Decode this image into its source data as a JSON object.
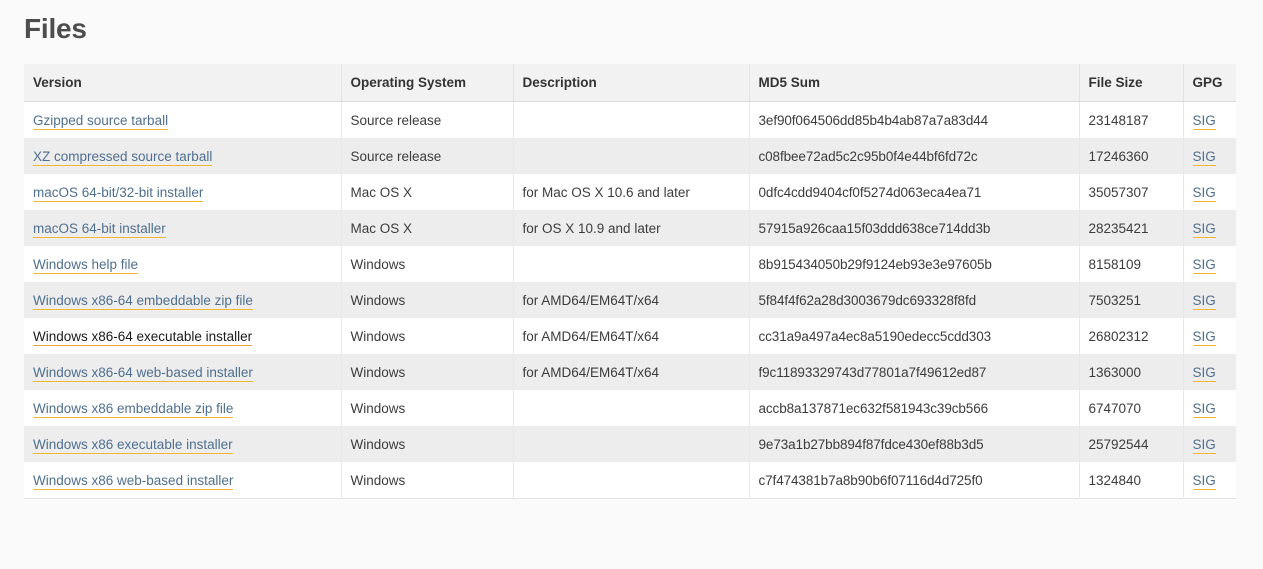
{
  "page": {
    "title": "Files",
    "background_color": "#fafafa",
    "link_color": "#4f6f8f",
    "link_underline_color": "#f2b632",
    "header_background": "#f2f2f2",
    "row_alt_background": "#ededed"
  },
  "table": {
    "columns": [
      {
        "key": "version",
        "label": "Version"
      },
      {
        "key": "os",
        "label": "Operating System"
      },
      {
        "key": "description",
        "label": "Description"
      },
      {
        "key": "md5",
        "label": "MD5 Sum"
      },
      {
        "key": "size",
        "label": "File Size"
      },
      {
        "key": "gpg",
        "label": "GPG"
      }
    ],
    "gpg_link_label": "SIG",
    "rows": [
      {
        "version": "Gzipped source tarball",
        "version_state": "normal",
        "os": "Source release",
        "description": "",
        "md5": "3ef90f064506dd85b4b4ab87a7a83d44",
        "size": "23148187",
        "gpg": "SIG"
      },
      {
        "version": "XZ compressed source tarball",
        "version_state": "normal",
        "os": "Source release",
        "description": "",
        "md5": "c08fbee72ad5c2c95b0f4e44bf6fd72c",
        "size": "17246360",
        "gpg": "SIG"
      },
      {
        "version": "macOS 64-bit/32-bit installer",
        "version_state": "normal",
        "os": "Mac OS X",
        "description": "for Mac OS X 10.6 and later",
        "md5": "0dfc4cdd9404cf0f5274d063eca4ea71",
        "size": "35057307",
        "gpg": "SIG"
      },
      {
        "version": "macOS 64-bit installer",
        "version_state": "normal",
        "os": "Mac OS X",
        "description": "for OS X 10.9 and later",
        "md5": "57915a926caa15f03ddd638ce714dd3b",
        "size": "28235421",
        "gpg": "SIG"
      },
      {
        "version": "Windows help file",
        "version_state": "normal",
        "os": "Windows",
        "description": "",
        "md5": "8b915434050b29f9124eb93e3e97605b",
        "size": "8158109",
        "gpg": "SIG"
      },
      {
        "version": "Windows x86-64 embeddable zip file",
        "version_state": "normal",
        "os": "Windows",
        "description": "for AMD64/EM64T/x64",
        "md5": "5f84f4f62a28d3003679dc693328f8fd",
        "size": "7503251",
        "gpg": "SIG"
      },
      {
        "version": "Windows x86-64 executable installer",
        "version_state": "hovered",
        "os": "Windows",
        "description": "for AMD64/EM64T/x64",
        "md5": "cc31a9a497a4ec8a5190edecc5cdd303",
        "size": "26802312",
        "gpg": "SIG"
      },
      {
        "version": "Windows x86-64 web-based installer",
        "version_state": "normal",
        "os": "Windows",
        "description": "for AMD64/EM64T/x64",
        "md5": "f9c11893329743d77801a7f49612ed87",
        "size": "1363000",
        "gpg": "SIG"
      },
      {
        "version": "Windows x86 embeddable zip file",
        "version_state": "normal",
        "os": "Windows",
        "description": "",
        "md5": "accb8a137871ec632f581943c39cb566",
        "size": "6747070",
        "gpg": "SIG"
      },
      {
        "version": "Windows x86 executable installer",
        "version_state": "normal",
        "os": "Windows",
        "description": "",
        "md5": "9e73a1b27bb894f87fdce430ef88b3d5",
        "size": "25792544",
        "gpg": "SIG"
      },
      {
        "version": "Windows x86 web-based installer",
        "version_state": "normal",
        "os": "Windows",
        "description": "",
        "md5": "c7f474381b7a8b90b6f07116d4d725f0",
        "size": "1324840",
        "gpg": "SIG"
      }
    ]
  }
}
